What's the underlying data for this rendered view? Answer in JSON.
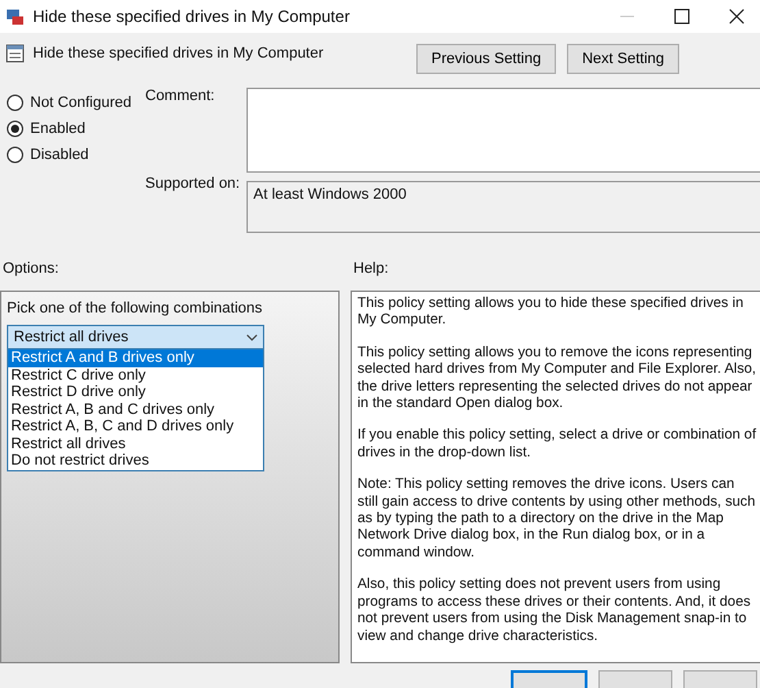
{
  "window": {
    "title": "Hide these specified drives in My Computer"
  },
  "header": {
    "title": "Hide these specified drives in My Computer",
    "buttons": [
      "Previous Setting",
      "Next Setting"
    ]
  },
  "state_options": [
    {
      "label": "Not Configured",
      "selected": false
    },
    {
      "label": "Enabled",
      "selected": true
    },
    {
      "label": "Disabled",
      "selected": false
    }
  ],
  "comment": {
    "label": "Comment:"
  },
  "supported_on": {
    "label": "Supported on:",
    "value": "At least Windows 2000"
  },
  "options": {
    "label": "Options:",
    "prompt": "Pick one of the following combinations",
    "dropdown": {
      "value": "Restrict all drives",
      "expanded": true,
      "items": [
        {
          "label": "Restrict A and B drives only",
          "highlighted": true
        },
        {
          "label": "Restrict C drive only",
          "highlighted": false
        },
        {
          "label": "Restrict D drive only",
          "highlighted": false
        },
        {
          "label": "Restrict A, B and C drives only",
          "highlighted": false
        },
        {
          "label": "Restrict A, B, C and D drives only",
          "highlighted": false
        },
        {
          "label": "Restrict all drives",
          "highlighted": false
        },
        {
          "label": "Do not restrict drives",
          "highlighted": false
        }
      ]
    }
  },
  "help": {
    "label": "Help:",
    "paragraphs": [
      "This policy setting allows you to hide these specified drives in My Computer.",
      "This policy setting allows you to remove the icons representing selected hard drives from My Computer and File Explorer. Also, the drive letters representing the selected drives do not appear in the standard Open dialog box.",
      "If you enable this policy setting, select a drive or combination of drives in the drop-down list.",
      "Note: This policy setting removes the drive icons. Users can still gain access to drive contents by using other methods, such as by typing the path to a directory on the drive in the Map Network Drive dialog box, in the Run dialog box, or in a command window.",
      "Also, this policy setting does not prevent users from using programs to access these drives or their contents. And, it does not prevent users from using the Disk Management snap-in to view and change drive characteristics."
    ]
  }
}
